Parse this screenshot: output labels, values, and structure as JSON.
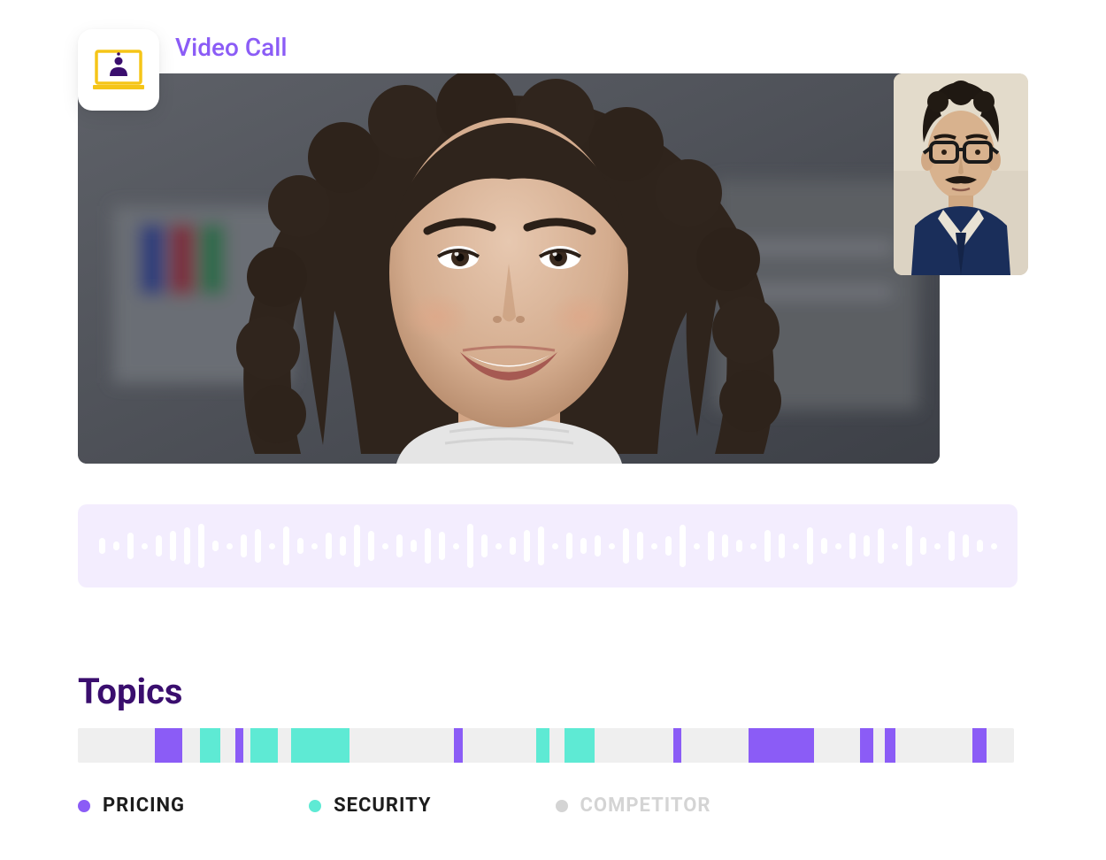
{
  "header": {
    "title": "Video Call"
  },
  "topics": {
    "heading": "Topics",
    "segments": [
      {
        "start": 8.2,
        "width": 3.0,
        "color": "purple"
      },
      {
        "start": 13.0,
        "width": 2.2,
        "color": "teal"
      },
      {
        "start": 16.8,
        "width": 0.9,
        "color": "purple"
      },
      {
        "start": 18.4,
        "width": 3.0,
        "color": "teal"
      },
      {
        "start": 22.8,
        "width": 6.2,
        "color": "teal"
      },
      {
        "start": 40.2,
        "width": 0.9,
        "color": "purple"
      },
      {
        "start": 49.0,
        "width": 1.4,
        "color": "teal"
      },
      {
        "start": 52.0,
        "width": 3.2,
        "color": "teal"
      },
      {
        "start": 63.6,
        "width": 0.9,
        "color": "purple"
      },
      {
        "start": 71.6,
        "width": 7.0,
        "color": "purple"
      },
      {
        "start": 83.6,
        "width": 1.4,
        "color": "purple"
      },
      {
        "start": 86.2,
        "width": 1.1,
        "color": "purple"
      },
      {
        "start": 95.6,
        "width": 1.5,
        "color": "purple"
      }
    ],
    "legend": [
      {
        "label": "PRICING",
        "color": "#8B5CF6",
        "textColor": "#1C1C1C"
      },
      {
        "label": "SECURITY",
        "color": "#5EEAD4",
        "textColor": "#1C1C1C"
      },
      {
        "label": "COMPETITOR",
        "color": "#D4D4D4",
        "textColor": "#D4D4D4"
      }
    ]
  },
  "waveform": {
    "bars": [
      18,
      10,
      30,
      8,
      24,
      34,
      42,
      50,
      12,
      8,
      26,
      38,
      8,
      44,
      18,
      8,
      30,
      22,
      48,
      34,
      8,
      26,
      14,
      40,
      32,
      8,
      50,
      26,
      8,
      20,
      36,
      44,
      8,
      30,
      18,
      24,
      8,
      40,
      32,
      8,
      22,
      48,
      8,
      34,
      26,
      14,
      8,
      36,
      28,
      8,
      42,
      18,
      8,
      30,
      24,
      40,
      8,
      46,
      20,
      8,
      34,
      26,
      14,
      8
    ]
  }
}
